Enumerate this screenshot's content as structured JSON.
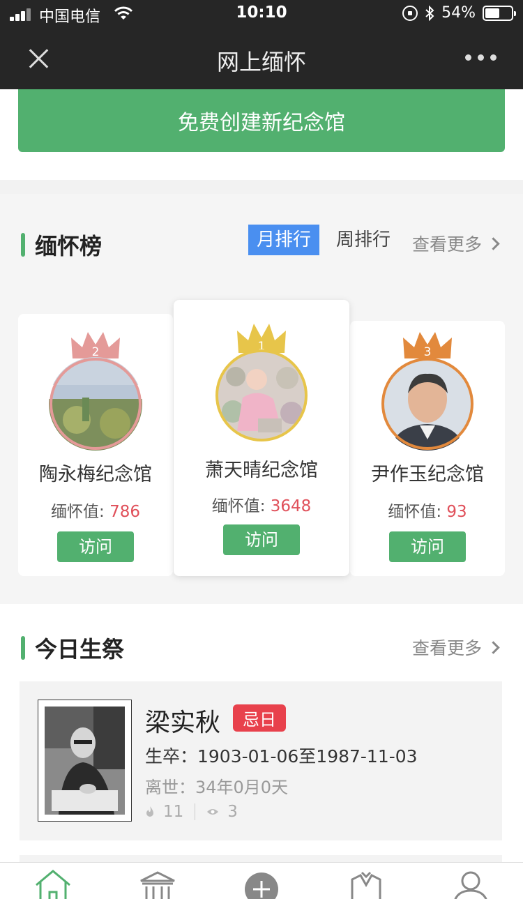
{
  "status": {
    "carrier": "中国电信",
    "time": "10:10",
    "battery": "54%"
  },
  "nav": {
    "title": "网上缅怀"
  },
  "create": {
    "label": "免费创建新纪念馆"
  },
  "ranking": {
    "title": "缅怀榜",
    "tabs": [
      "月排行",
      "周排行"
    ],
    "more": "查看更多",
    "value_label": "缅怀值:",
    "visit_label": "访问",
    "cards": [
      {
        "rank": "2",
        "name": "陶永梅纪念馆",
        "value": "786",
        "ring_color": "#e49a98"
      },
      {
        "rank": "1",
        "name": "萧天晴纪念馆",
        "value": "3648",
        "ring_color": "#e7c54a"
      },
      {
        "rank": "3",
        "name": "尹作玉纪念馆",
        "value": "93",
        "ring_color": "#e2893c"
      }
    ]
  },
  "today": {
    "title": "今日生祭",
    "more": "查看更多",
    "person": {
      "name": "梁实秋",
      "badge": "忌日",
      "life": "生卒：1903-01-06至1987-11-03",
      "passed": "离世：34年0月0天",
      "flowers": "11",
      "views": "3"
    }
  },
  "colors": {
    "accent": "#52b06f",
    "tab_active": "#4a8ff0",
    "value_red": "#e0505a",
    "badge_red": "#e8414c"
  }
}
